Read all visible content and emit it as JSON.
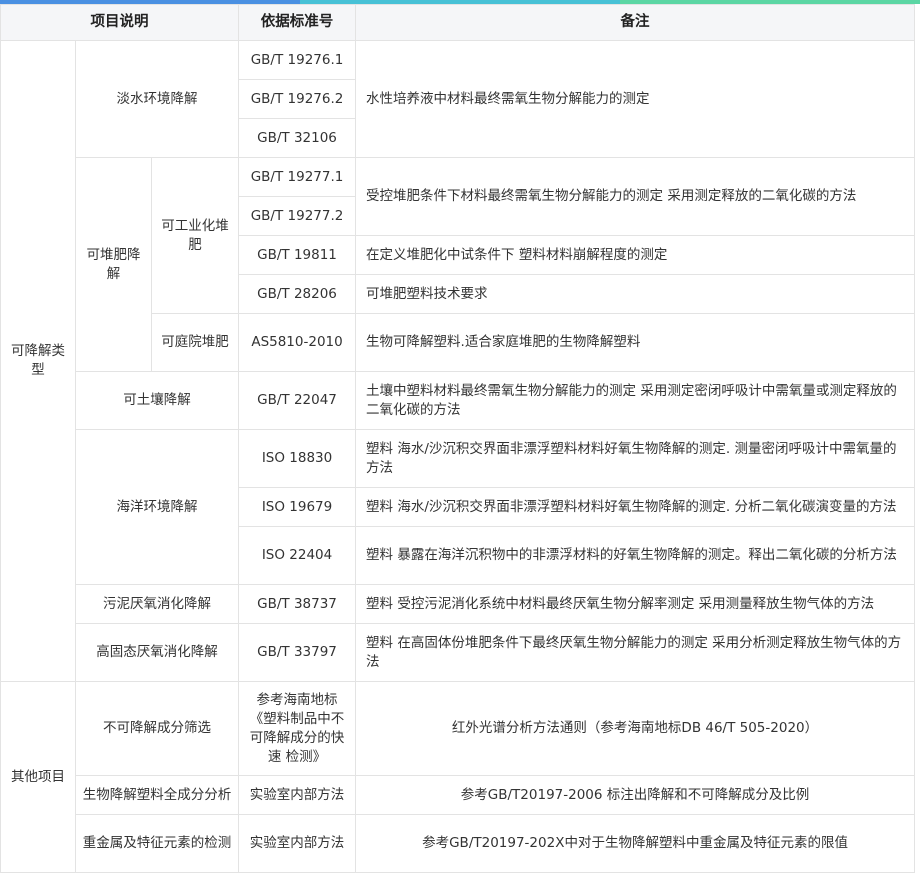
{
  "colors": {
    "accent_left": "#4a90e2",
    "accent_mid": "#47c1d6",
    "accent_right": "#5bd6a4"
  },
  "header": {
    "item": "项目说明",
    "standard": "依据标准号",
    "note": "备注"
  },
  "groups": {
    "degradable": "可降解类型",
    "other": "其他项目"
  },
  "sub": {
    "freshwater": "淡水环境降解",
    "compost": "可堆肥降解",
    "industrial": "可工业化堆肥",
    "garden": "可庭院堆肥",
    "soil": "可土壤降解",
    "marine": "海洋环境降解",
    "sludge": "污泥厌氧消化降解",
    "highsolid": "高固态厌氧消化降解",
    "nondeg": "不可降解成分筛选",
    "fullcomp": "生物降解塑料全成分分析",
    "heavymetal": "重金属及特征元素的检测"
  },
  "std": {
    "s1": "GB/T 19276.1",
    "s2": "GB/T 19276.2",
    "s3": "GB/T 32106",
    "s4": "GB/T 19277.1",
    "s5": "GB/T 19277.2",
    "s6": "GB/T 19811",
    "s7": "GB/T 28206",
    "s8": "AS5810-2010",
    "s9": "GB/T 22047",
    "s10": "ISO 18830",
    "s11": "ISO 19679",
    "s12": "ISO 22404",
    "s13": "GB/T 38737",
    "s14": "GB/T 33797",
    "s15": "参考海南地标《塑料制品中不可降解成分的快速 检测》",
    "s16": "实验室内部方法",
    "s17": "实验室内部方法"
  },
  "note": {
    "n1": "水性培养液中材料最终需氧生物分解能力的测定",
    "n2": "受控堆肥条件下材料最终需氧生物分解能力的测定 采用测定释放的二氧化碳的方法",
    "n3": "在定义堆肥化中试条件下 塑料材料崩解程度的测定",
    "n4": "可堆肥塑料技术要求",
    "n5": "生物可降解塑料.适合家庭堆肥的生物降解塑料",
    "n6": "土壤中塑料材料最终需氧生物分解能力的测定 采用测定密闭呼吸计中需氧量或测定释放的二氧化碳的方法",
    "n7": "塑料 海水/沙沉积交界面非漂浮塑料材料好氧生物降解的测定. 测量密闭呼吸计中需氧量的方法",
    "n8": "塑料 海水/沙沉积交界面非漂浮塑料材料好氧生物降解的测定. 分析二氧化碳演变量的方法",
    "n9": "塑料 暴露在海洋沉积物中的非漂浮材料的好氧生物降解的测定。释出二氧化碳的分析方法",
    "n10": "塑料 受控污泥消化系统中材料最终厌氧生物分解率测定 采用测量释放生物气体的方法",
    "n11": "塑料 在高固体份堆肥条件下最终厌氧生物分解能力的测定 采用分析测定释放生物气体的方法",
    "n12": "红外光谱分析方法通则（参考海南地标DB 46/T 505-2020）",
    "n13": "参考GB/T20197-2006 标注出降解和不可降解成分及比例",
    "n14": "参考GB/T20197-202X中对于生物降解塑料中重金属及特征元素的限值"
  }
}
